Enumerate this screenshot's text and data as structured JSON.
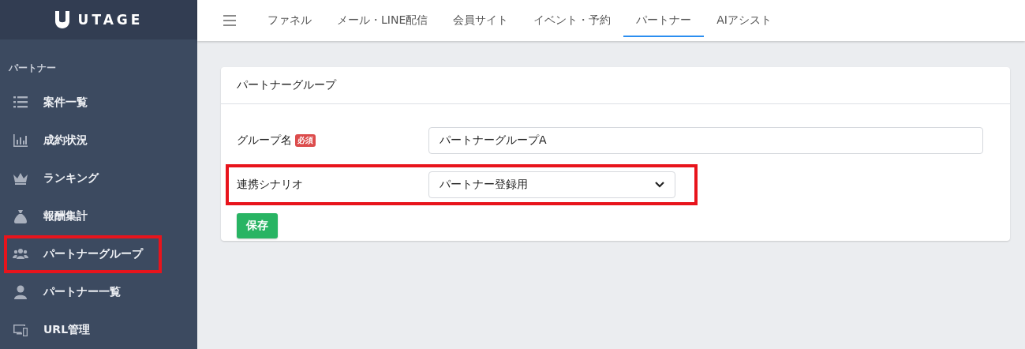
{
  "brand": {
    "name": "UTAGE"
  },
  "top_nav": [
    {
      "label": "ファネル",
      "selected": false
    },
    {
      "label": "メール・LINE配信",
      "selected": false
    },
    {
      "label": "会員サイト",
      "selected": false
    },
    {
      "label": "イベント・予約",
      "selected": false
    },
    {
      "label": "パートナー",
      "selected": true
    },
    {
      "label": "AIアシスト",
      "selected": false
    }
  ],
  "sidebar": {
    "section": "パートナー",
    "items": [
      {
        "label": "案件一覧",
        "highlighted": false
      },
      {
        "label": "成約状況",
        "highlighted": false
      },
      {
        "label": "ランキング",
        "highlighted": false
      },
      {
        "label": "報酬集計",
        "highlighted": false
      },
      {
        "label": "パートナーグループ",
        "highlighted": true
      },
      {
        "label": "パートナー一覧",
        "highlighted": false
      },
      {
        "label": "URL管理",
        "highlighted": false
      }
    ]
  },
  "card": {
    "title": "パートナーグループ",
    "fields": [
      {
        "kind": "text",
        "label": "グループ名",
        "badge": "必須",
        "value": "パートナーグループA",
        "highlighted": false
      },
      {
        "kind": "select",
        "label": "連携シナリオ",
        "value": "パートナー登録用",
        "highlighted": true
      }
    ],
    "save_button": "保存"
  }
}
